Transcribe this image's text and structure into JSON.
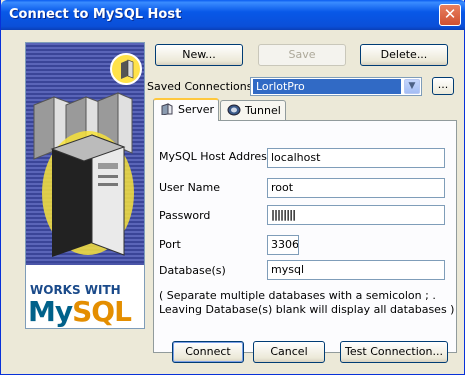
{
  "window": {
    "title": "Connect to MySQL Host",
    "close_label": "✕"
  },
  "banner": {
    "works_with": "WORKS WITH",
    "brand_my": "My",
    "brand_sql": "SQL"
  },
  "toolbar": {
    "new_label": "New...",
    "save_label": "Save",
    "delete_label": "Delete..."
  },
  "saved_connections": {
    "label": "Saved Connections:",
    "selected": "LorlotPro",
    "browse_label": "..."
  },
  "tabs": [
    {
      "label": "Server",
      "icon": "server-icon"
    },
    {
      "label": "Tunnel",
      "icon": "tunnel-icon"
    }
  ],
  "form": {
    "host_label": "MySQL Host Address",
    "host_value": "localhost",
    "user_label": "User Name",
    "user_value": "root",
    "password_label": "Password",
    "password_value": "||||||||",
    "port_label": "Port",
    "port_value": "3306",
    "database_label": "Database(s)",
    "database_value": "mysql",
    "note": "( Separate multiple databases with a semicolon ; . Leaving Database(s) blank will display all databases )"
  },
  "footer": {
    "connect_label": "Connect",
    "cancel_label": "Cancel",
    "test_label": "Test Connection..."
  }
}
